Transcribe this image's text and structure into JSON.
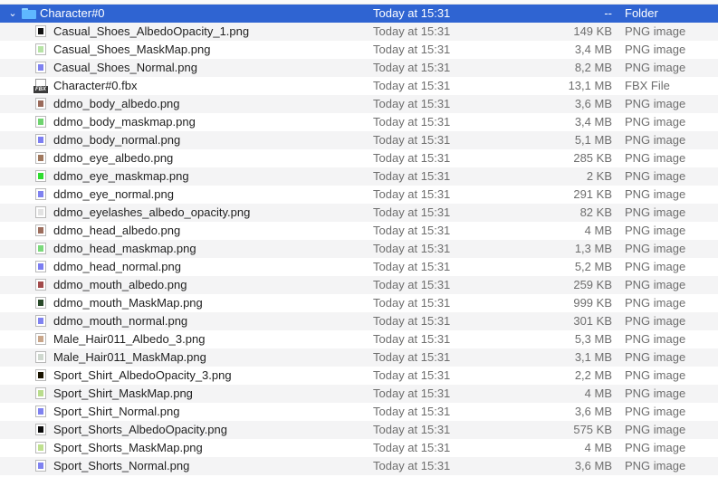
{
  "folder": {
    "name": "Character#0",
    "date": "Today at 15:31",
    "size": "--",
    "kind": "Folder",
    "expanded": true
  },
  "files": [
    {
      "name": "Casual_Shoes_AlbedoOpacity_1.png",
      "date": "Today at 15:31",
      "size": "149 KB",
      "kind": "PNG image",
      "thumb": "#111111"
    },
    {
      "name": "Casual_Shoes_MaskMap.png",
      "date": "Today at 15:31",
      "size": "3,4 MB",
      "kind": "PNG image",
      "thumb": "#b7e3a6"
    },
    {
      "name": "Casual_Shoes_Normal.png",
      "date": "Today at 15:31",
      "size": "8,2 MB",
      "kind": "PNG image",
      "thumb": "#7f82f0"
    },
    {
      "name": "Character#0.fbx",
      "date": "Today at 15:31",
      "size": "13,1 MB",
      "kind": "FBX File",
      "icon": "fbx-file-icon"
    },
    {
      "name": "ddmo_body_albedo.png",
      "date": "Today at 15:31",
      "size": "3,6 MB",
      "kind": "PNG image",
      "thumb": "#9a6a5a"
    },
    {
      "name": "ddmo_body_maskmap.png",
      "date": "Today at 15:31",
      "size": "3,4 MB",
      "kind": "PNG image",
      "thumb": "#6fd36f"
    },
    {
      "name": "ddmo_body_normal.png",
      "date": "Today at 15:31",
      "size": "5,1 MB",
      "kind": "PNG image",
      "thumb": "#7d7ff2"
    },
    {
      "name": "ddmo_eye_albedo.png",
      "date": "Today at 15:31",
      "size": "285 KB",
      "kind": "PNG image",
      "thumb": "#a0785e"
    },
    {
      "name": "ddmo_eye_maskmap.png",
      "date": "Today at 15:31",
      "size": "2 KB",
      "kind": "PNG image",
      "thumb": "#2fdc2f"
    },
    {
      "name": "ddmo_eye_normal.png",
      "date": "Today at 15:31",
      "size": "291 KB",
      "kind": "PNG image",
      "thumb": "#7f82f0"
    },
    {
      "name": "ddmo_eyelashes_albedo_opacity.png",
      "date": "Today at 15:31",
      "size": "82 KB",
      "kind": "PNG image",
      "thumb": "#e2e2e2"
    },
    {
      "name": "ddmo_head_albedo.png",
      "date": "Today at 15:31",
      "size": "4 MB",
      "kind": "PNG image",
      "thumb": "#9c6d5c"
    },
    {
      "name": "ddmo_head_maskmap.png",
      "date": "Today at 15:31",
      "size": "1,3 MB",
      "kind": "PNG image",
      "thumb": "#7bd97b"
    },
    {
      "name": "ddmo_head_normal.png",
      "date": "Today at 15:31",
      "size": "5,2 MB",
      "kind": "PNG image",
      "thumb": "#7c7ef1"
    },
    {
      "name": "ddmo_mouth_albedo.png",
      "date": "Today at 15:31",
      "size": "259 KB",
      "kind": "PNG image",
      "thumb": "#a24a4a"
    },
    {
      "name": "ddmo_mouth_MaskMap.png",
      "date": "Today at 15:31",
      "size": "999 KB",
      "kind": "PNG image",
      "thumb": "#2a4a2a"
    },
    {
      "name": "ddmo_mouth_normal.png",
      "date": "Today at 15:31",
      "size": "301 KB",
      "kind": "PNG image",
      "thumb": "#7f82f0"
    },
    {
      "name": "Male_Hair011_Albedo_3.png",
      "date": "Today at 15:31",
      "size": "5,3 MB",
      "kind": "PNG image",
      "thumb": "#c9a68a"
    },
    {
      "name": "Male_Hair011_MaskMap.png",
      "date": "Today at 15:31",
      "size": "3,1 MB",
      "kind": "PNG image",
      "thumb": "#cfd8cf"
    },
    {
      "name": "Sport_Shirt_AlbedoOpacity_3.png",
      "date": "Today at 15:31",
      "size": "2,2 MB",
      "kind": "PNG image",
      "thumb": "#1a1400"
    },
    {
      "name": "Sport_Shirt_MaskMap.png",
      "date": "Today at 15:31",
      "size": "4 MB",
      "kind": "PNG image",
      "thumb": "#b9dc8c"
    },
    {
      "name": "Sport_Shirt_Normal.png",
      "date": "Today at 15:31",
      "size": "3,6 MB",
      "kind": "PNG image",
      "thumb": "#7f82f0"
    },
    {
      "name": "Sport_Shorts_AlbedoOpacity.png",
      "date": "Today at 15:31",
      "size": "575 KB",
      "kind": "PNG image",
      "thumb": "#0a0a0a"
    },
    {
      "name": "Sport_Shorts_MaskMap.png",
      "date": "Today at 15:31",
      "size": "4 MB",
      "kind": "PNG image",
      "thumb": "#bfe08f"
    },
    {
      "name": "Sport_Shorts_Normal.png",
      "date": "Today at 15:31",
      "size": "3,6 MB",
      "kind": "PNG image",
      "thumb": "#7f82f0"
    }
  ],
  "colors": {
    "selection": "#2f64d2",
    "folder_icon": "#5fb7ff",
    "alt_row": "#f4f4f5",
    "secondary_text": "#6e6e6e"
  }
}
